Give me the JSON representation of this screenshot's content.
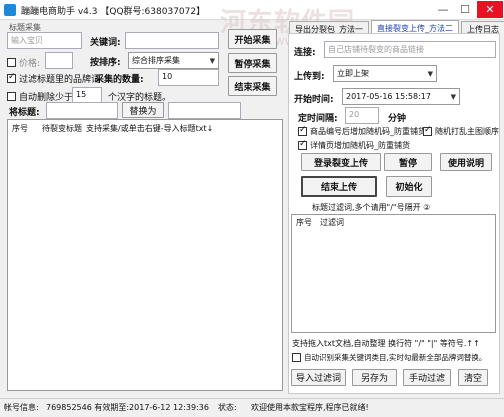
{
  "window": {
    "title": "蹦蹦电商助手 v4.3 【QQ群号:638037072】",
    "minimize": "—",
    "maximize": "☐",
    "close": "✕"
  },
  "watermark": {
    "text": "河东软件园",
    "url": "www.pc0359.cn"
  },
  "left": {
    "group_label": "标题采集",
    "item_input_placeholder": "输入宝贝",
    "keyword_label": "关键词:",
    "keyword_value": "",
    "price_label": "价格:",
    "price_from": "",
    "sort_label": "按排序:",
    "sort_value": "综合排序采集",
    "check_filter_brand": "过滤标题里的品牌词",
    "collect_count_label": "采集的数量:",
    "collect_count_value": "10",
    "check_auto_delete": "自动删除少于:",
    "min_chars_value": "15",
    "min_chars_suffix": "个汉字的标题。",
    "replace_title_label": "将标题:",
    "replace_from": "",
    "replace_to_label": "替换为",
    "replace_to": "",
    "btn_start": "开始采集",
    "btn_pause": "暂停采集",
    "btn_stop": "结束采集",
    "table_headers": [
      "序号",
      "待裂变标题",
      "支持采集/或单击右键-导入标题txt↓"
    ]
  },
  "right": {
    "tabs": [
      "导出分裂包_方法一",
      "直接裂变上传_方法二",
      "上传日志"
    ],
    "active_tab": 1,
    "link_label": "连接:",
    "link_placeholder": "自己店铺待裂变的商品链接",
    "upload_to_label": "上传到:",
    "upload_to_value": "立即上架",
    "start_time_label": "开始时间:",
    "start_time_value": "2017-05-16 15:58:17",
    "interval_label": "定时间隔:",
    "interval_value": "20",
    "interval_unit": "分钟",
    "check_code_append": "商品编号后增加随机码_防重铺货",
    "check_random_image": "随机打乱主图顺序",
    "check_detail_code": "详情页增加随机码_防重铺货",
    "btn_fission_upload": "登录裂变上传",
    "btn_pause": "暂停",
    "btn_help": "使用说明",
    "btn_end_upload": "结束上传",
    "btn_init": "初始化",
    "filter_label": "标题过滤词,多个请用\"/\"号隔开 ②",
    "filter_headers": [
      "序号",
      "过滤词"
    ],
    "txt_note": "支持拖入txt文档,自动整理 换行符 \"/\" \"|\" 等符号.↑↑",
    "check_auto_brand": "自动识别采集关键词类目,实时勾最新全部品牌词替换。",
    "btn_import": "导入过滤词",
    "btn_save_as": "另存为",
    "btn_manual_filter": "手动过滤",
    "btn_clear": "清空"
  },
  "status": {
    "account_label": "帐号信息:",
    "account_value": "769852546 有效期至:2017-6-12 12:39:36",
    "state_label": "状态:",
    "state_value": "欢迎使用本款宝程序,程序已就绪!"
  },
  "colors": {
    "accent": "#1d88d8",
    "tab_active": "#1d3fb3"
  }
}
